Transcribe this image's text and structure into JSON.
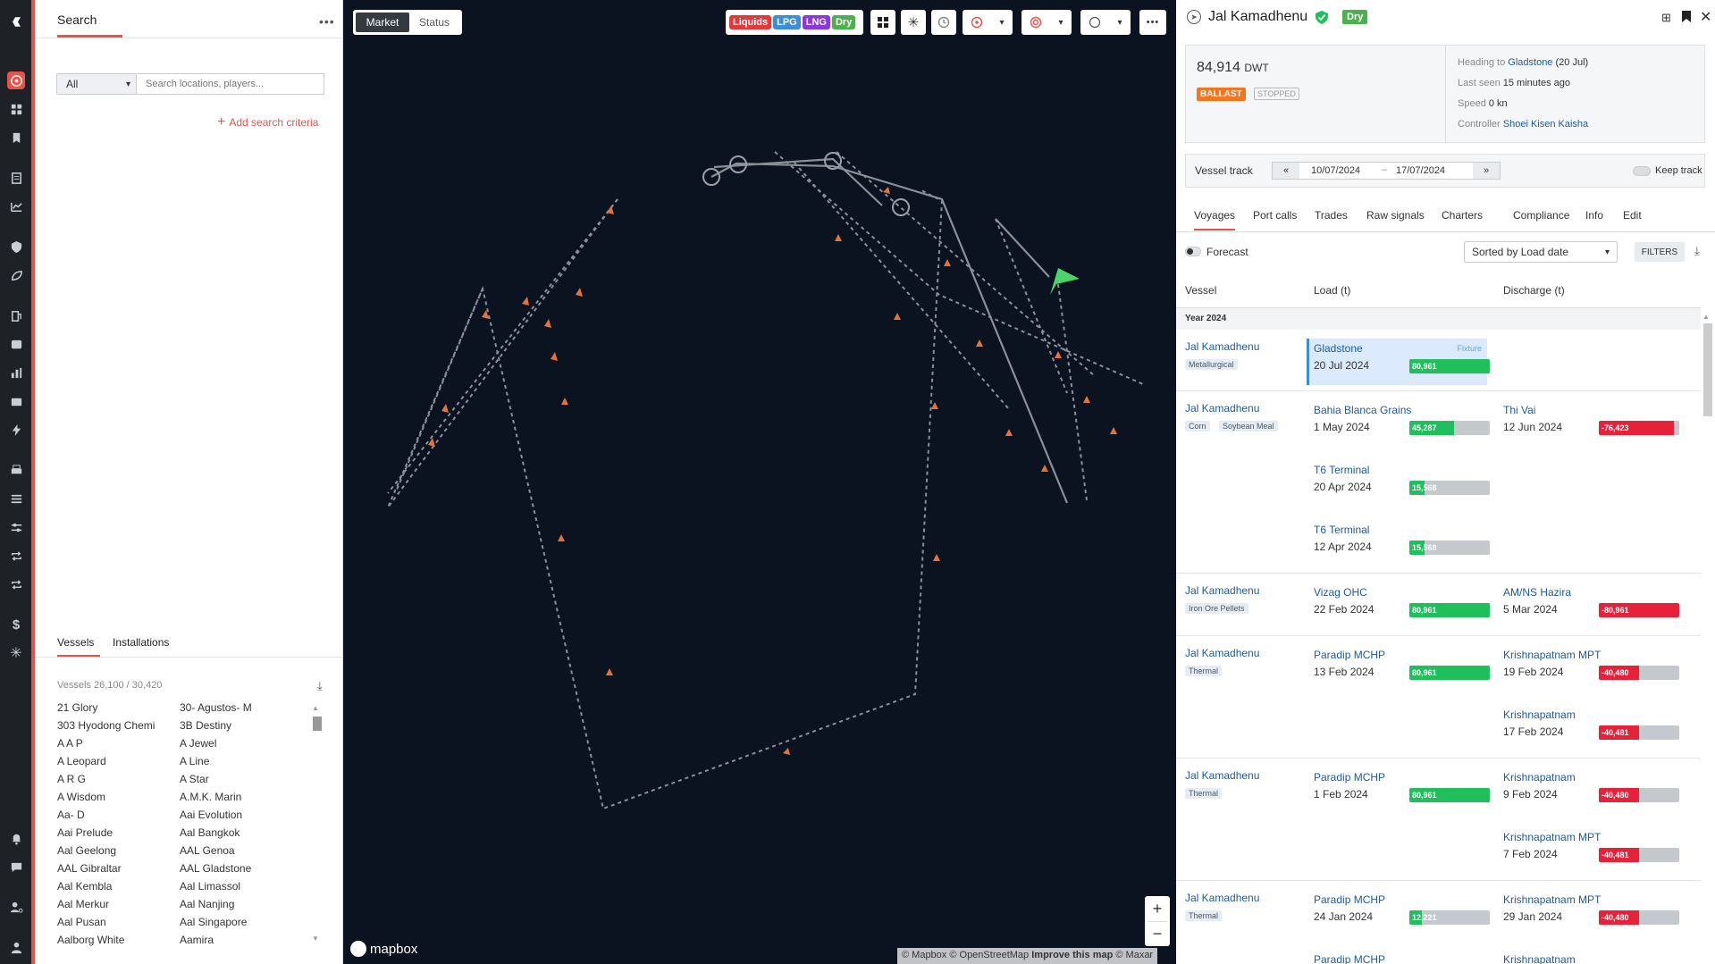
{
  "rail": {
    "icons": [
      "logo-icon",
      "target-icon",
      "dashboard-icon",
      "bookmark-icon",
      "document-icon",
      "chart-icon",
      "shield-icon",
      "leaf-icon",
      "fuel-icon",
      "oil-icon",
      "bar-chart-icon",
      "lng-icon",
      "bolt-icon",
      "print-icon",
      "list-icon",
      "settings-icon",
      "repeat-icon",
      "repeat2-icon",
      "dollar-icon",
      "snowflake-icon",
      "bell-icon",
      "chat-icon",
      "user-settings-icon",
      "user-icon"
    ]
  },
  "search": {
    "title": "Search",
    "filter_value": "All",
    "placeholder": "Search locations, players...",
    "add_criteria": "Add search criteria",
    "tabs": [
      "Vessels",
      "Installations"
    ],
    "count_text": "Vessels 26,100 / 30,420",
    "vessels_col1": [
      "21 Glory",
      "303 Hyodong Chemi",
      "A A P",
      "A Leopard",
      "A R G",
      "A Wisdom",
      "Aa- D",
      "Aai Prelude",
      "Aal Geelong",
      "AAL Gibraltar",
      "Aal Kembla",
      "Aal Merkur",
      "Aal Pusan",
      "Aalborg White"
    ],
    "vessels_col2": [
      "30- Agustos- M",
      "3B Destiny",
      "A Jewel",
      "A Line",
      "A Star",
      "A.M.K. Marin",
      "Aai Evolution",
      "Aal Bangkok",
      "AAL Genoa",
      "AAL Gladstone",
      "Aal Limassol",
      "Aal Nanjing",
      "Aal Singapore",
      "Aamira"
    ]
  },
  "map": {
    "toggle": [
      "Market",
      "Status"
    ],
    "tags": [
      {
        "label": "Liquids",
        "color": "#e03a3a"
      },
      {
        "label": "LPG",
        "color": "#3b8fd9"
      },
      {
        "label": "LNG",
        "color": "#8a3ad9"
      },
      {
        "label": "Dry",
        "color": "#4caf50"
      }
    ],
    "attribution": "© Mapbox © OpenStreetMap",
    "improve": "Improve this map",
    "maxar": "© Maxar",
    "brand": "mapbox",
    "zoom_in": "+",
    "zoom_out": "−"
  },
  "panel": {
    "vessel_name": "Jal Kamadhenu",
    "type_badge": "Dry",
    "dwt_value": "84,914",
    "dwt_unit": "DWT",
    "status1": "BALLAST",
    "status2": "STOPPED",
    "heading_label": "Heading to",
    "heading_port": "Gladstone",
    "heading_date": "(20 Jul)",
    "last_seen_label": "Last seen",
    "last_seen_value": "15 minutes ago",
    "speed_label": "Speed",
    "speed_value": "0 kn",
    "controller_label": "Controller",
    "controller_value": "Shoei Kisen Kaisha",
    "track_label": "Vessel track",
    "date_from": "10/07/2024",
    "date_sep": "–",
    "date_to": "17/07/2024",
    "keep_track": "Keep track",
    "tabs": [
      "Voyages",
      "Port calls",
      "Trades",
      "Raw signals",
      "Charters",
      "Compliance",
      "Info",
      "Edit"
    ],
    "forecast": "Forecast",
    "sort_value": "Sorted by Load date",
    "filters": "FILTERS",
    "col_vessel": "Vessel",
    "col_load": "Load (t)",
    "col_discharge": "Discharge (t)",
    "year": "Year 2024",
    "fixture": "Fixture",
    "voyages": [
      {
        "vessel": "Jal Kamadhenu",
        "cargo": [
          "Metallurgical"
        ],
        "load": [
          {
            "port": "Gladstone",
            "date": "20 Jul 2024",
            "qty": "80,961",
            "pct": 1.0
          }
        ],
        "discharge": []
      },
      {
        "vessel": "Jal Kamadhenu",
        "cargo": [
          "Corn",
          "Soybean Meal"
        ],
        "load": [
          {
            "port": "Bahia Blanca Grains",
            "date": "1 May 2024",
            "qty": "45,287",
            "pct": 0.55
          },
          {
            "port": "T6 Terminal",
            "date": "20 Apr 2024",
            "qty": "15,568",
            "pct": 0.19
          },
          {
            "port": "T6 Terminal",
            "date": "12 Apr 2024",
            "qty": "15,568",
            "pct": 0.19
          }
        ],
        "discharge": [
          {
            "port": "Thi Vai",
            "date": "12 Jun 2024",
            "qty": "-76,423",
            "pct": 0.93
          }
        ]
      },
      {
        "vessel": "Jal Kamadhenu",
        "cargo": [
          "Iron Ore Pellets"
        ],
        "load": [
          {
            "port": "Vizag OHC",
            "date": "22 Feb 2024",
            "qty": "80,961",
            "pct": 1.0
          }
        ],
        "discharge": [
          {
            "port": "AM/NS Hazira",
            "date": "5 Mar 2024",
            "qty": "-80,961",
            "pct": 1.0
          }
        ]
      },
      {
        "vessel": "Jal Kamadhenu",
        "cargo": [
          "Thermal"
        ],
        "load": [
          {
            "port": "Paradip MCHP",
            "date": "13 Feb 2024",
            "qty": "80,961",
            "pct": 1.0
          }
        ],
        "discharge": [
          {
            "port": "Krishnapatnam MPT",
            "date": "19 Feb 2024",
            "qty": "-40,480",
            "pct": 0.5
          },
          {
            "port": "Krishnapatnam",
            "date": "17 Feb 2024",
            "qty": "-40,481",
            "pct": 0.5
          }
        ]
      },
      {
        "vessel": "Jal Kamadhenu",
        "cargo": [
          "Thermal"
        ],
        "load": [
          {
            "port": "Paradip MCHP",
            "date": "1 Feb 2024",
            "qty": "80,961",
            "pct": 1.0
          }
        ],
        "discharge": [
          {
            "port": "Krishnapatnam",
            "date": "9 Feb 2024",
            "qty": "-40,480",
            "pct": 0.5
          },
          {
            "port": "Krishnapatnam MPT",
            "date": "7 Feb 2024",
            "qty": "-40,481",
            "pct": 0.5
          }
        ]
      },
      {
        "vessel": "Jal Kamadhenu",
        "cargo": [
          "Thermal"
        ],
        "load": [
          {
            "port": "Paradip MCHP",
            "date": "24 Jan 2024",
            "qty": "12,221",
            "pct": 0.15
          },
          {
            "port": "Paradip MCHP",
            "date": "",
            "qty": "",
            "pct": 0
          }
        ],
        "discharge": [
          {
            "port": "Krishnapatnam MPT",
            "date": "29 Jan 2024",
            "qty": "-40,480",
            "pct": 0.5
          },
          {
            "port": "Krishnapatnam",
            "date": "",
            "qty": "",
            "pct": 0
          }
        ]
      }
    ]
  },
  "colors": {
    "accent": "#e8524a",
    "green": "#1fbf5b",
    "red": "#e8213a",
    "link": "#1e5a9c",
    "map_bg": "#0b1320"
  }
}
